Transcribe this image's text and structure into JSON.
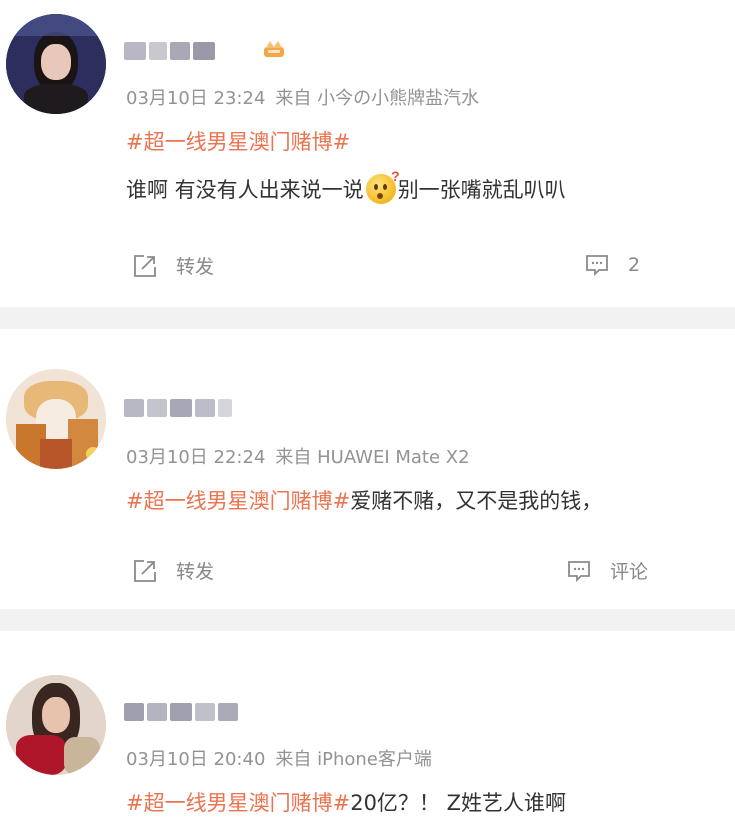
{
  "posts": [
    {
      "date": "03月10日 23:24",
      "source": "来自 小今の小熊牌盐汽水",
      "topic": "#超一线男星澳门赌博#",
      "text_before_emoji": "谁啊 有没有人出来说一说",
      "emoji": "doubt-emoji",
      "emoji_mark": "?",
      "text_after_emoji": "别一张嘴就乱叭叭",
      "repost_label": "转发",
      "comment_label": "2"
    },
    {
      "date": "03月10日 22:24",
      "source": "来自 HUAWEI Mate X2",
      "topic": "#超一线男星澳门赌博#",
      "text": "爱赌不赌，又不是我的钱，",
      "repost_label": "转发",
      "comment_label": "评论"
    },
    {
      "date": "03月10日 20:40",
      "source": "来自 iPhone客户端",
      "topic": "#超一线男星澳门赌博#",
      "text": "20亿？！ Z姓艺人谁啊"
    }
  ],
  "icons": {
    "repost": "repost-icon",
    "comment": "comment-icon",
    "badge": "crown-badge-icon"
  },
  "colors": {
    "topic": "#eb7350",
    "meta": "#939393",
    "text": "#333333",
    "action": "#888888",
    "divider": "#f2f2f2"
  }
}
